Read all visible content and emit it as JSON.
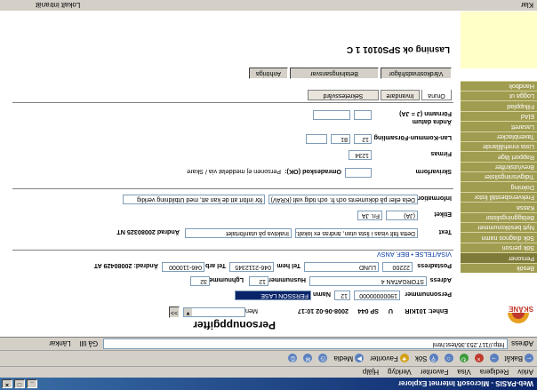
{
  "window": {
    "title": "Web-PASIS - Microsoft Internet Explorer"
  },
  "menu": [
    "Arkiv",
    "Redigera",
    "Visa",
    "Favoriter",
    "Verktyg",
    "Hjälp"
  ],
  "toolbar": {
    "back": "Bakåt",
    "search": "Sök",
    "favorites": "Favoriter",
    "media": "Media"
  },
  "address": {
    "label": "Adress",
    "url": "http://117.253.36/test.html",
    "go": "Gå till",
    "links": "Länkar"
  },
  "status": {
    "left": "Klar",
    "right": "Lokalt intranät"
  },
  "sidebar": {
    "logo_text": "SKÅNE",
    "items": [
      "Besök",
      "Personer",
      "Sök person",
      "Sök diagnos namn",
      "Nytt besöksnummer",
      "Beläggningslistor",
      "Kassa",
      "Frekvensbeställ listor",
      "Dokning",
      "Tidigvisningslister",
      "Brev/utskrifter",
      "Rapport läge",
      "Lista innehållande",
      "Taxenblacker",
      "Lasarett",
      "ElAd",
      "Fillupplad",
      "Logga ut",
      "Handbok"
    ]
  },
  "header": {
    "title": "Personuppgifter",
    "meny_label": "Meny",
    "go_btn": ">>"
  },
  "patient_line": {
    "enhet": "Enhet: 101KIR",
    "u": "U",
    "sp": "SP 044",
    "datetime": "2008-06-02 10:17"
  },
  "form": {
    "personnummer_label": "Personnummer",
    "personnummer": "19000000000",
    "personnummer_ext": "12",
    "namn_label": "Namn",
    "namn": "FERSSON LASE",
    "adress_label": "Adress",
    "adress": "STORGATAN 4",
    "husnummer_label": "Husnummer",
    "husnummer": "12",
    "lagenhet_label": "Lghnummer",
    "lagenhet": "32",
    "postadress_label": "Postadress",
    "postnr": "22200",
    "ort": "LUND",
    "tel_hem_label": "Tel hem",
    "tel_hem": "046-2112345",
    "tel_arb_label": "Tel arb",
    "tel_arb": "046-110000",
    "andrad": "Ändrad: 20080429 AT",
    "link_text": "VISA/TELSE • BEF, ANSV",
    "text_label": "Text",
    "text_value": "Detta fält visas i lista utan, ändras ex lokalt.",
    "text_value2": "Inaktiva på utanförtalet",
    "andrad2": "Ändrad 20080325 NT",
    "etikett_label": "Etiket",
    "etikett_val": "(JA)",
    "etikett_val2": "Fri. JA",
    "info_label": "Information",
    "info_value": "Dela eller på dokuments och fr. och tidig valt (KRAV)",
    "info_value2": "för infört att de kan att, med Utbildning verklig",
    "skrivare_label": "Skrivarform",
    "omr_label": "Omradeskod (OK):",
    "omr_text": "Personen ej meddelat via / Skare",
    "firma_label": "Firmas",
    "firma_value": "1234",
    "lan_label": "Lan-Kommun-Församling",
    "lan1": "12",
    "lan2": "81",
    "lan3": "",
    "andra_label": "Ändra datum",
    "fornamn_label": "Förnamn (J = JA)"
  },
  "tabs": {
    "inner": [
      "Oruna",
      "Invandare",
      "Sekretessvård"
    ],
    "outer": [
      "Vårdkostnadsfrågor",
      "Betalningsansvar",
      "Anhöriga"
    ]
  },
  "page_title": "Lasning ok SPS0101 1 C"
}
